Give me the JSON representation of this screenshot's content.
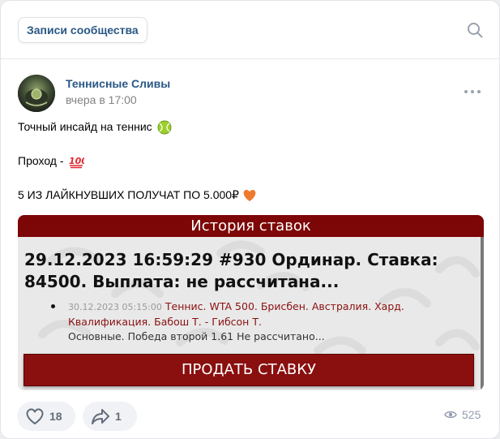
{
  "topbar": {
    "tab_label": "Записи сообщества"
  },
  "post": {
    "author": "Теннисные Сливы",
    "time": "вчера в 17:00",
    "lines": [
      "Точный инсайд на теннис",
      "Проход -",
      "5 ИЗ ЛАЙКНУВШИХ ПОЛУЧАТ ПО 5.000₽"
    ]
  },
  "attachment": {
    "header": "История ставок",
    "bet_title": "29.12.2023 16:59:29 #930 Ординар. Ставка: 84500. Выплата: не рассчитана...",
    "bet_date": "30.12.2023 05:15:00",
    "bet_event": "Теннис. WTA 500. Брисбен. Австралия. Хард. Квалификация. Бабош Т. - Гибсон Т.",
    "bet_result": "Основные. Победа второй 1.61 Не рассчитано...",
    "sell_button": "ПРОДАТЬ СТАВКУ"
  },
  "footer": {
    "likes": "18",
    "shares": "1",
    "views": "525"
  },
  "colors": {
    "link": "#2a5885",
    "banner": "#7d0606",
    "button": "#8a0f0f"
  }
}
